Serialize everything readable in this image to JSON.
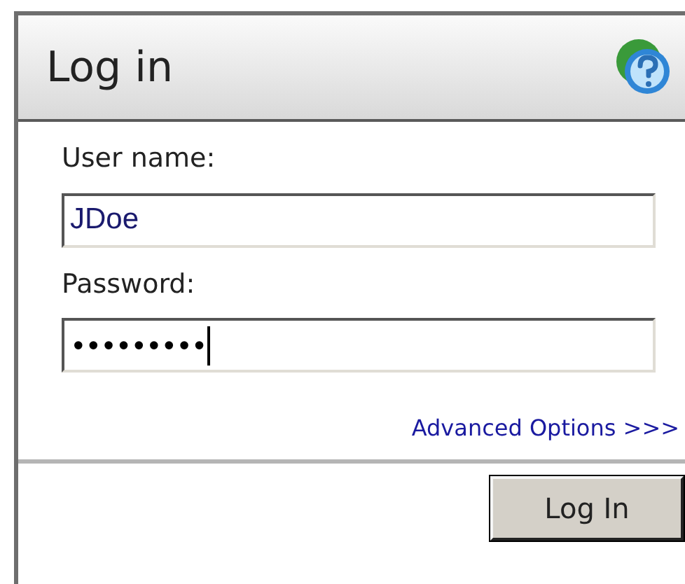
{
  "panel": {
    "title": "Log in"
  },
  "fields": [
    {
      "label": "User name:",
      "value": "JDoe",
      "kind": "text"
    },
    {
      "label": "Password:",
      "value": "•••••••••",
      "kind": "password"
    }
  ],
  "link": "Advanced Options >>>",
  "button": "Log In"
}
